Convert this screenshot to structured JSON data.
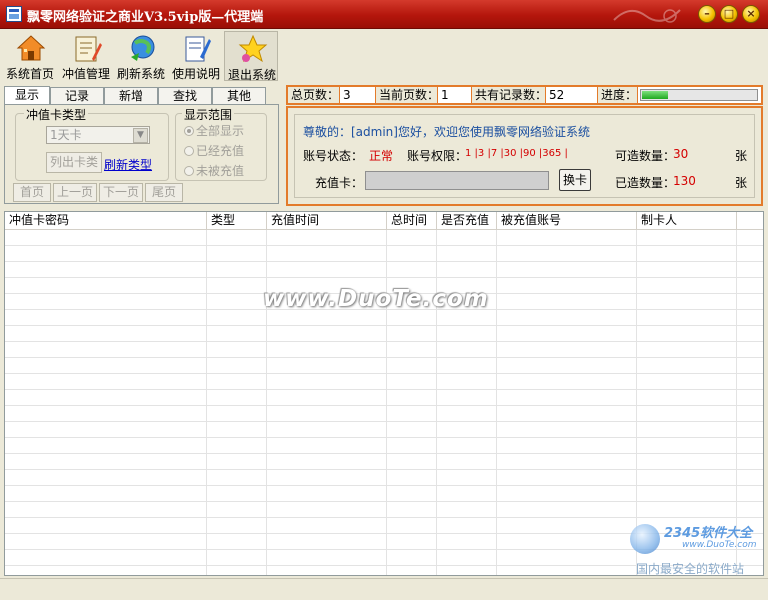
{
  "window": {
    "title": "飘零网络验证之商业V3.5vip版—代理端",
    "controls": {
      "minimize": "–",
      "maximize": "□",
      "close": "×"
    }
  },
  "toolbar": {
    "items": [
      {
        "label": "系统首页",
        "icon": "home-icon"
      },
      {
        "label": "冲值管理",
        "icon": "recharge-icon"
      },
      {
        "label": "刷新系统",
        "icon": "refresh-icon"
      },
      {
        "label": "使用说明",
        "icon": "help-icon"
      },
      {
        "label": "退出系统",
        "icon": "exit-icon"
      }
    ]
  },
  "tabs": [
    "显示",
    "记录",
    "新增",
    "查找",
    "其他"
  ],
  "left_panel": {
    "card_type_group": "冲值卡类型",
    "card_type_value": "1天卡",
    "list_button": "列出卡类",
    "refresh_link": "刷新类型",
    "range_group": "显示范围",
    "radios": [
      "全部显示",
      "已经充值",
      "未被充值"
    ],
    "pager": [
      "首页",
      "上一页",
      "下一页",
      "尾页"
    ]
  },
  "stats": {
    "total_pages_label": "总页数：",
    "total_pages": "3",
    "current_page_label": "当前页数：",
    "current_page": "1",
    "records_label": "共有记录数：",
    "records": "52",
    "progress_label": "进度：",
    "progress": 0.22
  },
  "info": {
    "welcome": "尊敬的：[admin]您好，欢迎您使用飘零网络验证系统",
    "status_label": "账号状态：",
    "status_value": "正常",
    "permission_label": "账号权限：",
    "permission_value": "1 |3 |7 |30 |90 |365 |",
    "available_label": "可造数量：",
    "available_value": "30",
    "made_label": "已造数量：",
    "made_value": "130",
    "unit": "张",
    "card_label": "充值卡：",
    "card_input": "",
    "swap_button": "换卡"
  },
  "grid": {
    "columns": [
      "冲值卡密码",
      "类型",
      "充值时间",
      "总时间",
      "是否充值",
      "被充值账号",
      "制卡人"
    ]
  },
  "watermark": "www.DuoTe.com",
  "logo": {
    "brand": "2345软件大全",
    "url": "www.DuoTe.com",
    "tagline": "国内最安全的软件站"
  },
  "colors": {
    "title_bar": "#b4160c",
    "accent_border": "#e37b2b",
    "status_ok": "#d40000",
    "link": "#0000cc"
  }
}
